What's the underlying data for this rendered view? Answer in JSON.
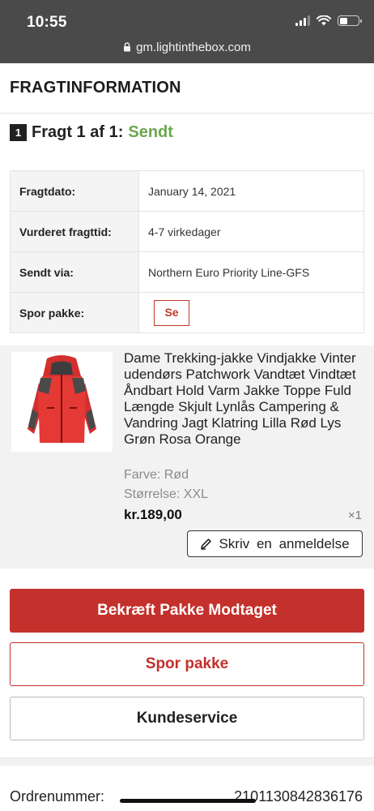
{
  "status_bar": {
    "time": "10:55",
    "icons": [
      "signal-icon",
      "wifi-icon",
      "battery-icon"
    ]
  },
  "browser": {
    "url": "gm.lightinthebox.com"
  },
  "page": {
    "title": "FRAGTINFORMATION"
  },
  "shipment": {
    "number": "1",
    "heading": "Fragt 1 af 1:",
    "status": "Sendt",
    "status_color": "#6aa84f",
    "rows": [
      {
        "label": "Fragtdato:",
        "value": "January 14, 2021"
      },
      {
        "label": "Vurderet fragttid:",
        "value": "4-7 virkedager"
      },
      {
        "label": "Sendt via:",
        "value": "Northern Euro Priority Line-GFS"
      },
      {
        "label": "Spor pakke:",
        "button": "Se"
      }
    ]
  },
  "product": {
    "name": "Dame Trekking-jakke Vindjakke Vinter udendørs Patchwork Vandtæt Vindtæt Åndbart Hold Varm Jakke Toppe Fuld Længde Skjult Lynlås Campering & Vandring Jagt Klatring Lilla Rød Lys Grøn Rosa Orange",
    "color": "Farve: Rød",
    "size": "Størrelse: XXL",
    "price": "kr.189,00",
    "quantity": "×1",
    "review_button": "Skriv en anmeldelse"
  },
  "actions": {
    "confirm": "Bekræft Pakke Modtaget",
    "track": "Spor pakke",
    "service": "Kundeservice"
  },
  "order": {
    "label": "Ordrenummer:",
    "value": "2101130842836176"
  },
  "colors": {
    "accent": "#c4302b",
    "sent": "#6aa84f",
    "chrome": "#4a4a4a"
  }
}
